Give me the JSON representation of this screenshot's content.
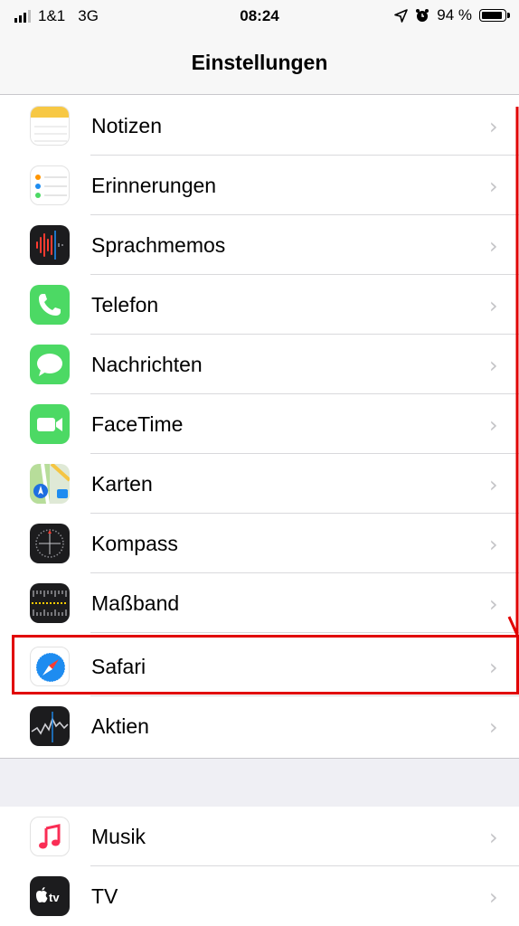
{
  "status_bar": {
    "carrier": "1&1",
    "network": "3G",
    "time": "08:24",
    "battery": "94 %"
  },
  "nav": {
    "title": "Einstellungen"
  },
  "items_group1": [
    {
      "label": "Notizen",
      "icon": "notes-icon"
    },
    {
      "label": "Erinnerungen",
      "icon": "reminders-icon"
    },
    {
      "label": "Sprachmemos",
      "icon": "voice-memos-icon"
    },
    {
      "label": "Telefon",
      "icon": "phone-icon"
    },
    {
      "label": "Nachrichten",
      "icon": "messages-icon"
    },
    {
      "label": "FaceTime",
      "icon": "facetime-icon"
    },
    {
      "label": "Karten",
      "icon": "maps-icon"
    },
    {
      "label": "Kompass",
      "icon": "compass-icon"
    },
    {
      "label": "Maßband",
      "icon": "measure-icon"
    },
    {
      "label": "Safari",
      "icon": "safari-icon"
    },
    {
      "label": "Aktien",
      "icon": "stocks-icon"
    }
  ],
  "items_group2": [
    {
      "label": "Musik",
      "icon": "music-icon"
    },
    {
      "label": "TV",
      "icon": "tv-icon"
    }
  ],
  "tv_icon_text": "tv",
  "chevron": "›",
  "colors": {
    "annotation": "#e10000",
    "phone_green": "#4cd964",
    "safari_blue": "#1e8cf0"
  }
}
